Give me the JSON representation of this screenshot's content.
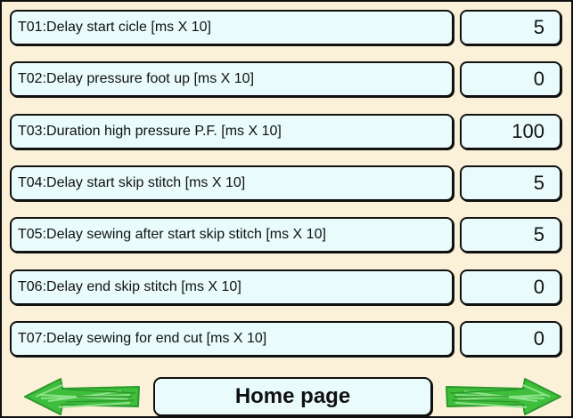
{
  "parameters": [
    {
      "label": "T01:Delay start cicle [ms X 10]",
      "value": "5"
    },
    {
      "label": "T02:Delay pressure foot up [ms X 10]",
      "value": "0"
    },
    {
      "label": "T03:Duration high pressure P.F. [ms X 10]",
      "value": "100"
    },
    {
      "label": "T04:Delay start skip stitch [ms X 10]",
      "value": "5"
    },
    {
      "label": "T05:Delay sewing after start skip stitch [ms X 10]",
      "value": "5"
    },
    {
      "label": "T06:Delay end skip stitch [ms X 10]",
      "value": "0"
    },
    {
      "label": "T07:Delay sewing for end cut [ms X 10]",
      "value": "0"
    }
  ],
  "nav": {
    "home_label": "Home page",
    "prev_icon": "arrow-left-icon",
    "next_icon": "arrow-right-icon"
  },
  "colors": {
    "background": "#fbf0d8",
    "box_fill": "#e9fcfb",
    "arrow_green": "#3fbe3c"
  }
}
